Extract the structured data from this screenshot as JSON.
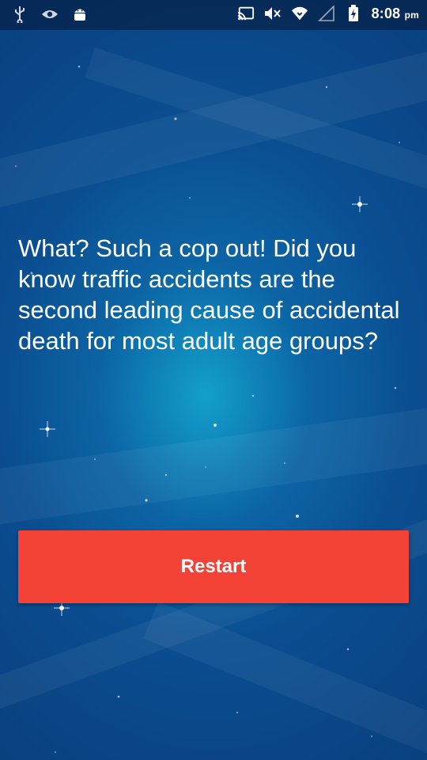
{
  "status_bar": {
    "time": "8:08",
    "ampm": "pm",
    "left_icons": [
      "usb-icon",
      "eye-icon",
      "android-icon"
    ],
    "right_icons": [
      "cast-icon",
      "mute-icon",
      "wifi-icon",
      "signal-icon",
      "battery-charging-icon"
    ]
  },
  "main": {
    "message": "What? Such a cop out! Did you know traffic accidents are the second leading cause of accidental death for most adult age groups?",
    "restart_label": "Restart"
  },
  "colors": {
    "button": "#f44336",
    "background": "#0b3f7a",
    "glow": "#14aad2"
  }
}
